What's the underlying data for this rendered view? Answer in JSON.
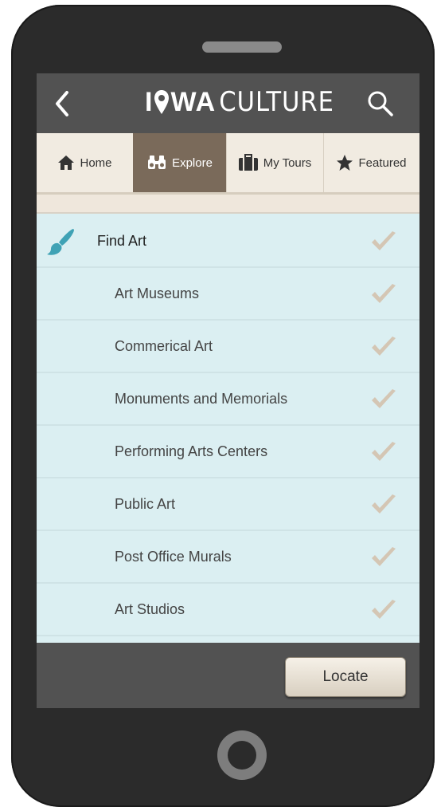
{
  "header": {
    "logo_bold": "IOWA",
    "logo_light": "CULTURE"
  },
  "tabs": [
    {
      "label": "Home",
      "icon": "home-icon",
      "active": false
    },
    {
      "label": "Explore",
      "icon": "binoculars-icon",
      "active": true
    },
    {
      "label": "My Tours",
      "icon": "suitcase-icon",
      "active": false
    },
    {
      "label": "Featured",
      "icon": "star-icon",
      "active": false
    }
  ],
  "category": {
    "label": "Find Art",
    "icon": "paintbrush-icon"
  },
  "items": [
    {
      "label": "Art Museums"
    },
    {
      "label": "Commerical Art"
    },
    {
      "label": "Monuments and Memorials"
    },
    {
      "label": "Performing Arts Centers"
    },
    {
      "label": "Public Art"
    },
    {
      "label": "Post Office Murals"
    },
    {
      "label": "Art Studios"
    }
  ],
  "footer": {
    "locate_label": "Locate"
  },
  "colors": {
    "topbar": "#525252",
    "active_tab": "#7a6a5a",
    "list_bg": "#dbeff2",
    "accent": "#3fa2b5",
    "check": "#d4c6b4"
  }
}
